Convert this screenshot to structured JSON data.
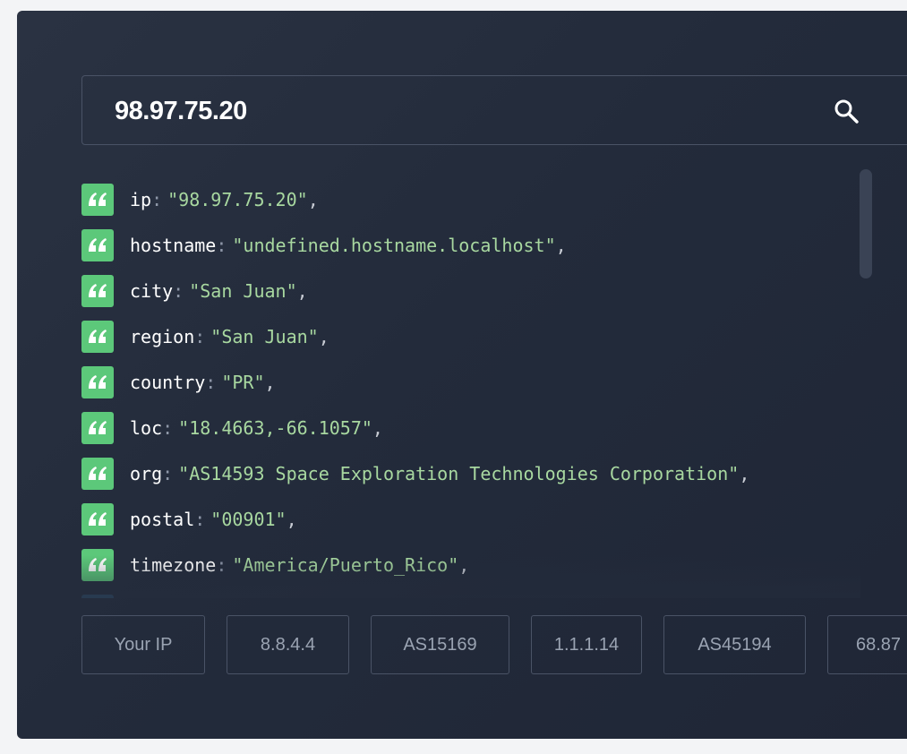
{
  "search": {
    "value": "98.97.75.20",
    "icon": "search-icon"
  },
  "result": {
    "rows": [
      {
        "key": "ip",
        "value": "\"98.97.75.20\"",
        "comma": ","
      },
      {
        "key": "hostname",
        "value": "\"undefined.hostname.localhost\"",
        "comma": ","
      },
      {
        "key": "city",
        "value": "\"San Juan\"",
        "comma": ","
      },
      {
        "key": "region",
        "value": "\"San Juan\"",
        "comma": ","
      },
      {
        "key": "country",
        "value": "\"PR\"",
        "comma": ","
      },
      {
        "key": "loc",
        "value": "\"18.4663,-66.1057\"",
        "comma": ","
      },
      {
        "key": "org",
        "value": "\"AS14593 Space Exploration Technologies Corporation\"",
        "comma": ","
      },
      {
        "key": "postal",
        "value": "\"00901\"",
        "comma": ","
      },
      {
        "key": "timezone",
        "value": "\"America/Puerto_Rico\"",
        "comma": ","
      }
    ],
    "colon": ":",
    "badge_icon": "quote-icon",
    "badge_color": "#5cc87a"
  },
  "chips": [
    "Your IP",
    "8.8.4.4",
    "AS15169",
    "1.1.1.14",
    "AS45194",
    "68.87"
  ]
}
